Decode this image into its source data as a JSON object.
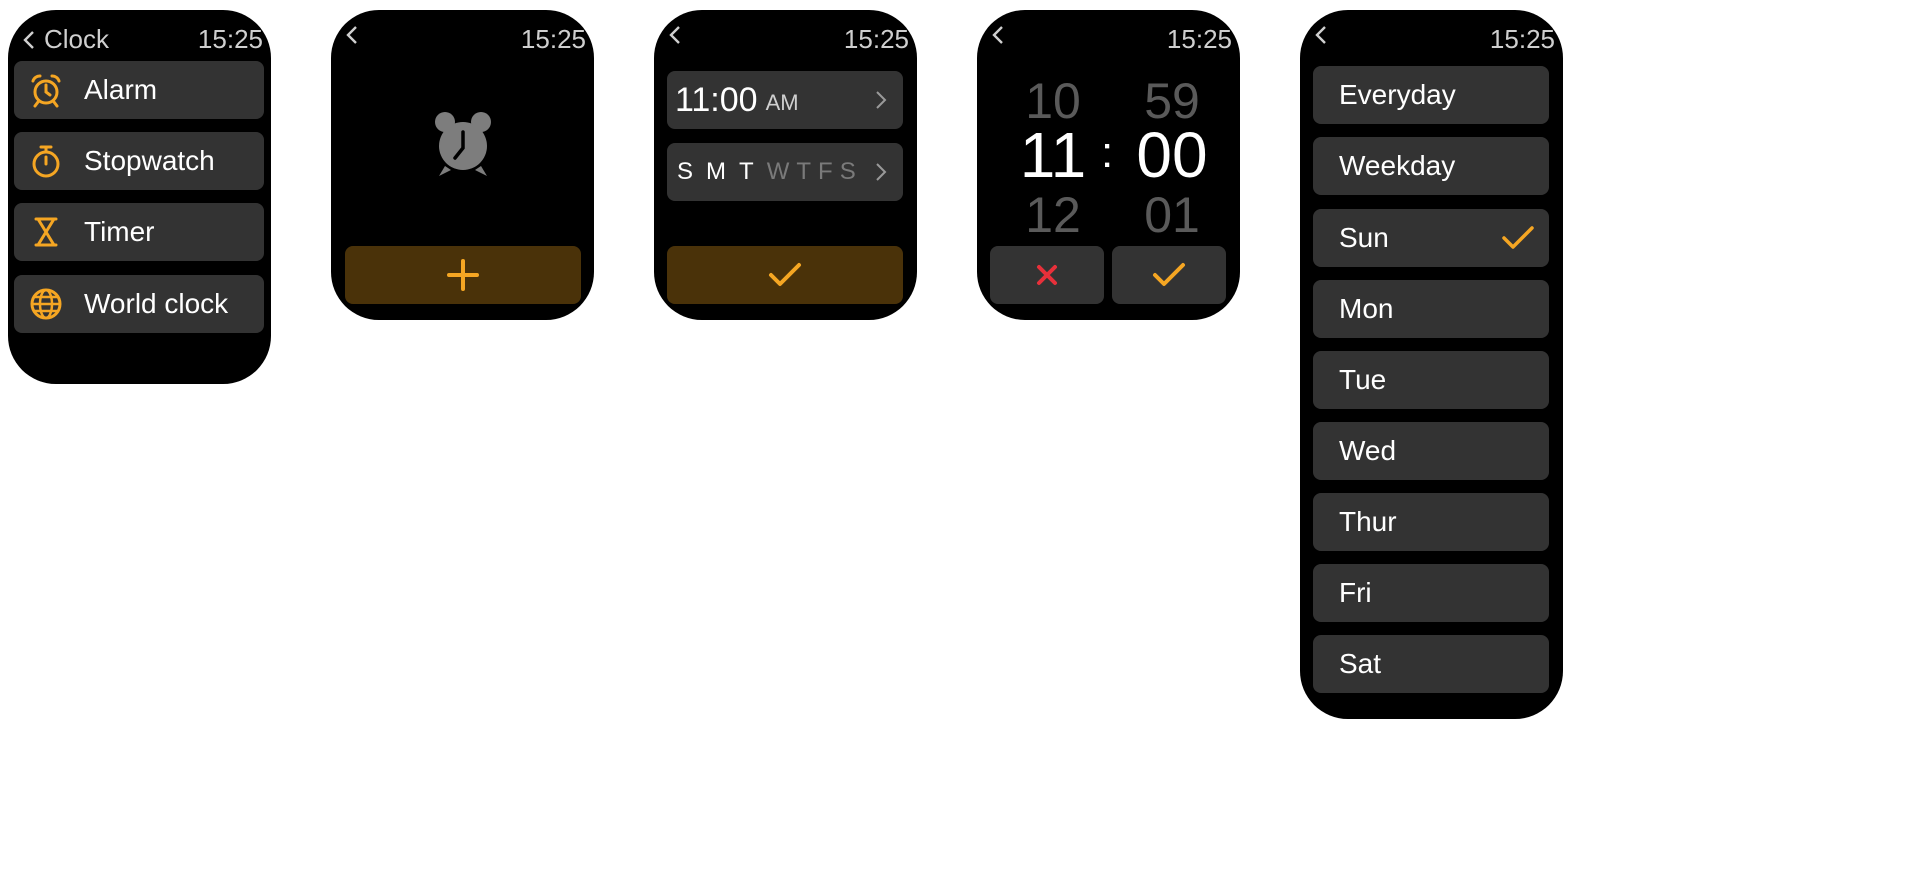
{
  "status_time": "15:25",
  "screen1": {
    "title": "Clock",
    "items": [
      {
        "label": "Alarm",
        "icon": "alarm-icon"
      },
      {
        "label": "Stopwatch",
        "icon": "stopwatch-icon"
      },
      {
        "label": "Timer",
        "icon": "hourglass-icon"
      },
      {
        "label": "World clock",
        "icon": "globe-icon"
      }
    ]
  },
  "screen2": {
    "empty_icon": "alarm-clock-icon",
    "add_icon": "plus-icon"
  },
  "screen3": {
    "time_value": "11:00",
    "ampm": "AM",
    "days": [
      {
        "letter": "S",
        "active": true
      },
      {
        "letter": "M",
        "active": true
      },
      {
        "letter": "T",
        "active": true
      },
      {
        "letter": "W",
        "active": false
      },
      {
        "letter": "T",
        "active": false
      },
      {
        "letter": "F",
        "active": false
      },
      {
        "letter": "S",
        "active": false
      }
    ],
    "confirm_icon": "check-icon"
  },
  "screen4": {
    "hour_prev": "10",
    "hour_current": "11",
    "hour_next": "12",
    "separator": ":",
    "minute_prev": "59",
    "minute_current": "00",
    "minute_next": "01",
    "cancel_icon": "close-icon",
    "confirm_icon": "check-icon"
  },
  "screen5": {
    "options": [
      {
        "label": "Everyday",
        "selected": false
      },
      {
        "label": "Weekday",
        "selected": false
      },
      {
        "label": "Sun",
        "selected": true
      },
      {
        "label": "Mon",
        "selected": false
      },
      {
        "label": "Tue",
        "selected": false
      },
      {
        "label": "Wed",
        "selected": false
      },
      {
        "label": "Thur",
        "selected": false
      },
      {
        "label": "Fri",
        "selected": false
      },
      {
        "label": "Sat",
        "selected": false
      }
    ]
  },
  "colors": {
    "accent": "#f5a623",
    "cancel": "#e8303a",
    "card": "#333333",
    "amber_button": "#4a3209",
    "dim_text": "#5a5a5a",
    "inactive_day": "#7a7a7a"
  }
}
